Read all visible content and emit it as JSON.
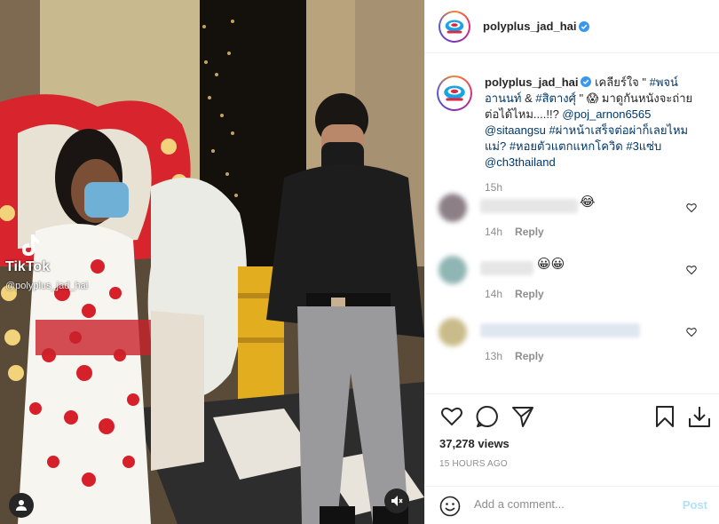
{
  "video": {
    "watermark_name": "TikTok",
    "watermark_handle": "@polyplus_jad_hai",
    "user_tag_icon": "user-icon",
    "mute_icon": "muted-speaker-icon"
  },
  "post": {
    "username": "polyplus_jad_hai",
    "verified": true,
    "caption": {
      "text_1": "เคลียร์ใจ \" ",
      "tag_1": "#พจน์ อานนท์",
      "text_2": " & ",
      "tag_2": "#สิตางศุ์",
      "text_3": " \" 😱 มาดูกันหนังจะถ่ายต่อได้ไหม....!!? ",
      "mention_1": "@poj_arnon6565",
      "mention_2": "@sitaangsu",
      "tag_3": "#ผ่าหน้าเสร็จต่อผ่าก็เลยไหม แม่?",
      "tag_4": "#หอยตัวแตกแหกโควิด",
      "tag_5": "#3แซ่บ",
      "mention_3": "@ch3thailand",
      "time": "15h"
    },
    "comments": [
      {
        "emoji": "😂",
        "time": "14h",
        "reply_label": "Reply"
      },
      {
        "emoji": "😀😀",
        "time": "14h",
        "reply_label": "Reply"
      },
      {
        "emoji": "",
        "time": "13h",
        "reply_label": "Reply"
      }
    ],
    "views": "37,278 views",
    "time_ago": "15 HOURS AGO",
    "comment_placeholder": "Add a comment...",
    "post_label": "Post"
  },
  "colors": {
    "link": "#00376b",
    "verified": "#3897f0",
    "muted": "#8e8e8e",
    "post_disabled": "#b2dffc"
  }
}
